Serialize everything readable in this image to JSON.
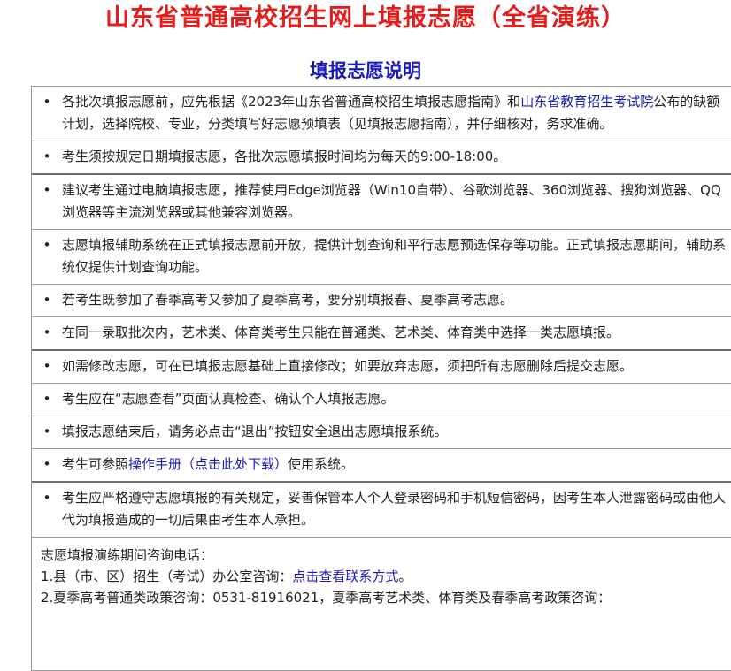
{
  "header": {
    "title": "山东省普通高校招生网上填报志愿（全省演练）",
    "subtitle": "填报志愿说明"
  },
  "notices": [
    {
      "before": "各批次填报志愿前，应先根据《2023年山东省普通高校招生填报志愿指南》和",
      "link": "山东省教育招生考试院",
      "after": "公布的缺额计划，选择院校、专业，分类填写好志愿预填表（见填报志愿指南），并仔细核对，务求准确。"
    },
    {
      "text": "考生须按规定日期填报志愿，各批次志愿填报时间均为每天的9:00-18:00。"
    },
    {
      "text": "建议考生通过电脑填报志愿，推荐使用Edge浏览器（Win10自带）、谷歌浏览器、360浏览器、搜狗浏览器、QQ浏览器等主流浏览器或其他兼容浏览器。"
    },
    {
      "text": "志愿填报辅助系统在正式填报志愿前开放，提供计划查询和平行志愿预选保存等功能。正式填报志愿期间，辅助系统仅提供计划查询功能。"
    },
    {
      "text": "若考生既参加了春季高考又参加了夏季高考，要分别填报春、夏季高考志愿。"
    },
    {
      "text": "在同一录取批次内，艺术类、体育类考生只能在普通类、艺术类、体育类中选择一类志愿填报。"
    },
    {
      "text": "如需修改志愿，可在已填报志愿基础上直接修改；如要放弃志愿，须把所有志愿删除后提交志愿。"
    },
    {
      "text": "考生应在“志愿查看”页面认真检查、确认个人填报志愿。"
    },
    {
      "text": "填报志愿结束后，请务必点击“退出”按钮安全退出志愿填报系统。"
    },
    {
      "before": "考生可参照",
      "link": "操作手册（点击此处下载）",
      "after": "使用系统。"
    },
    {
      "text": "考生应严格遵守志愿填报的有关规定，妥善保管本人个人登录密码和手机短信密码，因考生本人泄露密码或由他人代为填报造成的一切后果由考生本人承担。"
    }
  ],
  "contact": {
    "title": "志愿填报演练期间咨询电话：",
    "line1_prefix": "1.县（市、区）招生（考试）办公室咨询：",
    "line1_link": "点击查看联系方式",
    "line1_suffix": "。",
    "line2": "2.夏季高考普通类政策咨询：0531-81916021，夏季高考艺术类、体育类及春季高考政策咨询："
  },
  "colors": {
    "title_red": "#e31c1c",
    "subtitle_blue": "#1a1ab8",
    "link_blue": "#1a1ab8",
    "border_gray": "#9a9a9a"
  }
}
